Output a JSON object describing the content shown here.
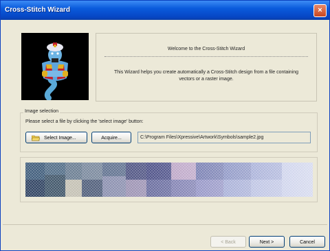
{
  "window": {
    "title": "Cross-Stitch Wizard",
    "close_symbol": "×"
  },
  "welcome": {
    "title": "Welcome to the Cross-Stitch Wizard",
    "description": "This Wizard helps you create automatically a Cross-Stitch design from a file containing vectors or a raster image."
  },
  "image_selection": {
    "group_label": "Image selection",
    "instruction": "Please select a file by clicking the 'select image' button:",
    "select_button": "Select Image...",
    "acquire_button": "Acquire...",
    "file_path": "C:\\Program Files\\Xpressive\\Artwork\\Symbols\\sample2.jpg"
  },
  "buttons": {
    "back": "< Back",
    "next": "Next >",
    "cancel": "Cancel"
  },
  "colors": {
    "title_bar": "#0a5bdc",
    "dialog_bg": "#ece9d8",
    "preview_blue": "#3a3f8a"
  }
}
